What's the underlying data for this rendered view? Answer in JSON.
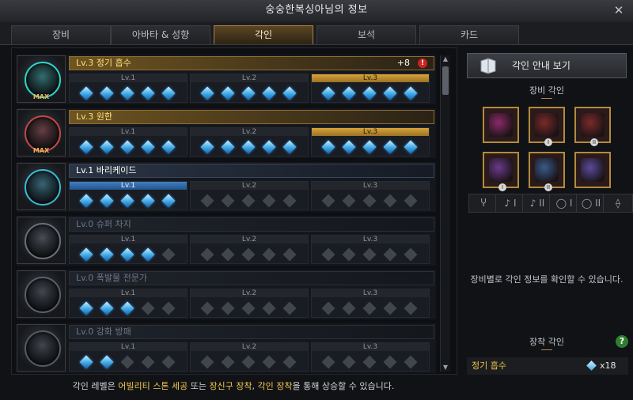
{
  "window": {
    "title": "숭숭한복싱아님의 정보",
    "close_glyph": "✕"
  },
  "tabs": [
    {
      "label": "장비",
      "active": false
    },
    {
      "label": "아바타 & 성향",
      "active": false
    },
    {
      "label": "각인",
      "active": true
    },
    {
      "label": "보석",
      "active": false
    },
    {
      "label": "카드",
      "active": false
    }
  ],
  "engravings": [
    {
      "title": "Lv.3 정기 흡수",
      "max_label": "MAX",
      "bonus": "+8",
      "alert": "!",
      "style": "gold",
      "icon": "engraving-absorb-icon",
      "levels": [
        {
          "label": "Lv.1",
          "state": "normal",
          "gems": 5
        },
        {
          "label": "Lv.2",
          "state": "normal",
          "gems": 5
        },
        {
          "label": "Lv.3",
          "state": "gold",
          "gems": 5
        }
      ]
    },
    {
      "title": "Lv.3 원한",
      "max_label": "MAX",
      "bonus": "",
      "alert": "",
      "style": "gold",
      "icon": "engraving-grudge-icon",
      "levels": [
        {
          "label": "Lv.1",
          "state": "normal",
          "gems": 5
        },
        {
          "label": "Lv.2",
          "state": "normal",
          "gems": 5
        },
        {
          "label": "Lv.3",
          "state": "gold",
          "gems": 5
        }
      ]
    },
    {
      "title": "Lv.1 바리케이드",
      "max_label": "",
      "bonus": "",
      "alert": "",
      "style": "blue",
      "icon": "engraving-barricade-icon",
      "levels": [
        {
          "label": "Lv.1",
          "state": "blue",
          "gems": 5
        },
        {
          "label": "Lv.2",
          "state": "normal",
          "gems": 0
        },
        {
          "label": "Lv.3",
          "state": "normal",
          "gems": 0
        }
      ]
    },
    {
      "title": "Lv.0 슈퍼 차지",
      "max_label": "",
      "bonus": "",
      "alert": "",
      "style": "dim",
      "icon": "engraving-supercharge-icon",
      "levels": [
        {
          "label": "Lv.1",
          "state": "normal",
          "gems": 4
        },
        {
          "label": "Lv.2",
          "state": "normal",
          "gems": 0
        },
        {
          "label": "Lv.3",
          "state": "normal",
          "gems": 0
        }
      ]
    },
    {
      "title": "Lv.0 폭발물 전문가",
      "max_label": "",
      "bonus": "",
      "alert": "",
      "style": "dim",
      "icon": "engraving-explosive-icon",
      "levels": [
        {
          "label": "Lv.1",
          "state": "normal",
          "gems": 3
        },
        {
          "label": "Lv.2",
          "state": "normal",
          "gems": 0
        },
        {
          "label": "Lv.3",
          "state": "normal",
          "gems": 0
        }
      ]
    },
    {
      "title": "Lv.0 강화 방패",
      "max_label": "",
      "bonus": "",
      "alert": "",
      "style": "dim",
      "icon": "engraving-shield-icon",
      "levels": [
        {
          "label": "Lv.1",
          "state": "normal",
          "gems": 2
        },
        {
          "label": "Lv.2",
          "state": "normal",
          "gems": 0
        },
        {
          "label": "Lv.3",
          "state": "normal",
          "gems": 0
        }
      ]
    }
  ],
  "side": {
    "guide_button": "각인 안내 보기",
    "equip_engraving_title": "장비 각인",
    "equipment": [
      {
        "name": "necklace-icon",
        "tier": "",
        "color": "#8b2a6a"
      },
      {
        "name": "earring-icon",
        "tier": "I",
        "color": "#7a2a2a"
      },
      {
        "name": "earring-icon",
        "tier": "II",
        "color": "#7a2a2a"
      },
      {
        "name": "ring-icon",
        "tier": "I",
        "color": "#6a3a8a"
      },
      {
        "name": "ring-icon",
        "tier": "II",
        "color": "#3a5a8a"
      },
      {
        "name": "stone-icon",
        "tier": "",
        "color": "#5a4a9a"
      }
    ],
    "slots": [
      "Ⴤ",
      "♪ I",
      "♪ II",
      "◯ I",
      "◯ II",
      "⟠"
    ],
    "info_text": "장비별로 각인 정보를 확인할 수 있습니다.",
    "equipped_title": "장착 각인",
    "help_glyph": "?",
    "equipped": [
      {
        "name": "정기 흡수",
        "count": "x18"
      }
    ]
  },
  "footer": {
    "part1": "각인 레벨은 ",
    "y1": "어빌리티 스톤 세공",
    "part2": " 또는 ",
    "y2": "장신구 장착",
    "part3": ", ",
    "y3": "각인 장착",
    "part4": "을 통해 상승할 수 있습니다."
  }
}
